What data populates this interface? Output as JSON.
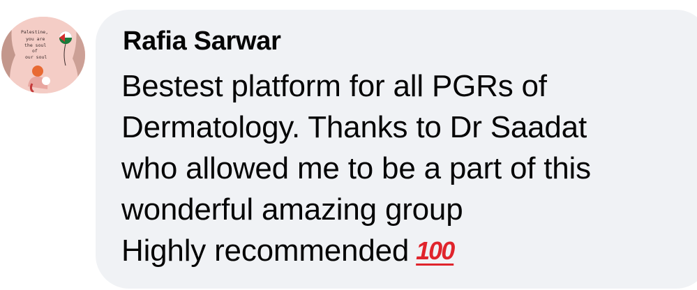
{
  "comment": {
    "author": "Rafia Sarwar",
    "avatar_text": "Palestine, you are the soul of our soul",
    "body_lines": [
      "Bestest platform for all PGRs of",
      "Dermatology. Thanks to Dr Saadat",
      "who allowed me to be a part of this",
      "wonderful amazing group",
      "Highly recommended"
    ],
    "emoji": "100",
    "emoji_icon": "hundred-points-icon",
    "colors": {
      "bubble": "#f0f2f5",
      "text": "#050505",
      "emoji": "#e0242c"
    }
  }
}
